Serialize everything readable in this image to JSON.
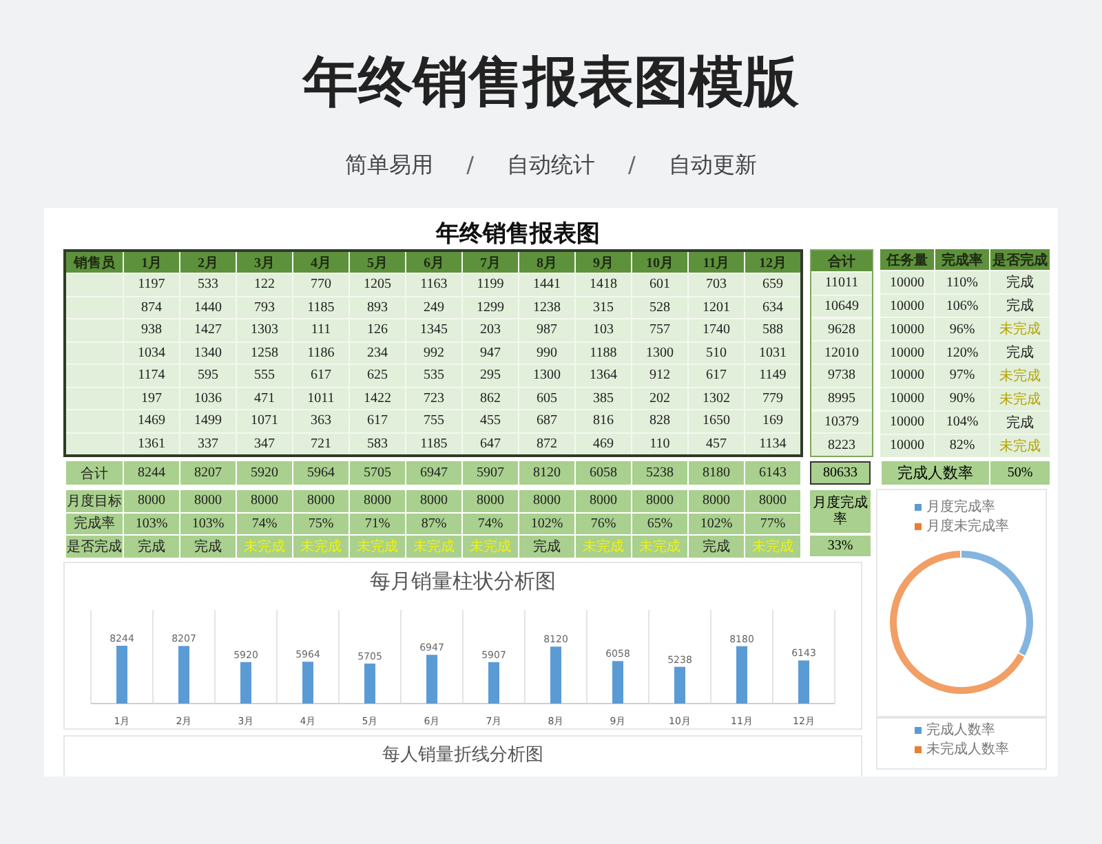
{
  "page_title": "年终销售报表图模版",
  "features": [
    "简单易用",
    "自动统计",
    "自动更新"
  ],
  "feature_separator": "/",
  "sheet_title": "年终销售报表图",
  "sales_table": {
    "columns": [
      "销售员",
      "1月",
      "2月",
      "3月",
      "4月",
      "5月",
      "6月",
      "7月",
      "8月",
      "9月",
      "10月",
      "11月",
      "12月"
    ],
    "rows": [
      {
        "values": [
          "1197",
          "533",
          "122",
          "770",
          "1205",
          "1163",
          "1199",
          "1441",
          "1418",
          "601",
          "703",
          "659"
        ]
      },
      {
        "values": [
          "874",
          "1440",
          "793",
          "1185",
          "893",
          "249",
          "1299",
          "1238",
          "315",
          "528",
          "1201",
          "634"
        ]
      },
      {
        "values": [
          "938",
          "1427",
          "1303",
          "111",
          "126",
          "1345",
          "203",
          "987",
          "103",
          "757",
          "1740",
          "588"
        ]
      },
      {
        "values": [
          "1034",
          "1340",
          "1258",
          "1186",
          "234",
          "992",
          "947",
          "990",
          "1188",
          "1300",
          "510",
          "1031"
        ]
      },
      {
        "values": [
          "1174",
          "595",
          "555",
          "617",
          "625",
          "535",
          "295",
          "1300",
          "1364",
          "912",
          "617",
          "1149"
        ]
      },
      {
        "values": [
          "197",
          "1036",
          "471",
          "1011",
          "1422",
          "723",
          "862",
          "605",
          "385",
          "202",
          "1302",
          "779"
        ]
      },
      {
        "values": [
          "1469",
          "1499",
          "1071",
          "363",
          "617",
          "755",
          "455",
          "687",
          "816",
          "828",
          "1650",
          "169"
        ]
      },
      {
        "values": [
          "1361",
          "337",
          "347",
          "721",
          "583",
          "1185",
          "647",
          "872",
          "469",
          "110",
          "457",
          "1134"
        ]
      }
    ]
  },
  "totals_column": {
    "header": "合计",
    "values": [
      "11011",
      "10649",
      "9628",
      "12010",
      "9738",
      "8995",
      "10379",
      "8223"
    ]
  },
  "task_table": {
    "columns": [
      "任务量",
      "完成率",
      "是否完成"
    ],
    "rows": [
      {
        "task": "10000",
        "rate": "110%",
        "status": "完成",
        "completed": true
      },
      {
        "task": "10000",
        "rate": "106%",
        "status": "完成",
        "completed": true
      },
      {
        "task": "10000",
        "rate": "96%",
        "status": "未完成",
        "completed": false
      },
      {
        "task": "10000",
        "rate": "120%",
        "status": "完成",
        "completed": true
      },
      {
        "task": "10000",
        "rate": "97%",
        "status": "未完成",
        "completed": false
      },
      {
        "task": "10000",
        "rate": "90%",
        "status": "未完成",
        "completed": false
      },
      {
        "task": "10000",
        "rate": "104%",
        "status": "完成",
        "completed": true
      },
      {
        "task": "10000",
        "rate": "82%",
        "status": "未完成",
        "completed": false
      }
    ]
  },
  "monthly_summary": {
    "total_label": "合计",
    "totals": [
      "8244",
      "8207",
      "5920",
      "5964",
      "5705",
      "6947",
      "5907",
      "8120",
      "6058",
      "5238",
      "8180",
      "6143"
    ],
    "grand_total": "80633",
    "target_label": "月度目标",
    "targets": [
      "8000",
      "8000",
      "8000",
      "8000",
      "8000",
      "8000",
      "8000",
      "8000",
      "8000",
      "8000",
      "8000",
      "8000"
    ],
    "rate_label": "完成率",
    "rates": [
      "103%",
      "103%",
      "74%",
      "75%",
      "71%",
      "87%",
      "74%",
      "102%",
      "76%",
      "65%",
      "102%",
      "77%"
    ],
    "status_label": "是否完成",
    "statuses": [
      {
        "text": "完成",
        "completed": true
      },
      {
        "text": "完成",
        "completed": true
      },
      {
        "text": "未完成",
        "completed": false
      },
      {
        "text": "未完成",
        "completed": false
      },
      {
        "text": "未完成",
        "completed": false
      },
      {
        "text": "未完成",
        "completed": false
      },
      {
        "text": "未完成",
        "completed": false
      },
      {
        "text": "完成",
        "completed": true
      },
      {
        "text": "未完成",
        "completed": false
      },
      {
        "text": "未完成",
        "completed": false
      },
      {
        "text": "完成",
        "completed": true
      },
      {
        "text": "未完成",
        "completed": false
      }
    ]
  },
  "monthly_rate": {
    "label": "月度完成率",
    "value": "33%"
  },
  "person_rate": {
    "label": "完成人数率",
    "value": "50%"
  },
  "bar_chart": {
    "chart_data": {
      "type": "bar",
      "title": "每月销量柱状分析图",
      "categories": [
        "1月",
        "2月",
        "3月",
        "4月",
        "5月",
        "6月",
        "7月",
        "8月",
        "9月",
        "10月",
        "11月",
        "12月"
      ],
      "values": [
        8244,
        8207,
        5920,
        5964,
        5705,
        6947,
        5907,
        8120,
        6058,
        5238,
        8180,
        6143
      ],
      "value_labels": [
        "8244",
        "8207",
        "5920",
        "5964",
        "5705",
        "6947",
        "5907",
        "8120",
        "6058",
        "5238",
        "8180",
        "6143"
      ]
    }
  },
  "line_chart": {
    "title": "每人销量折线分析图"
  },
  "donut_chart": {
    "chart_data": {
      "type": "donut",
      "categories": [
        "月度完成率",
        "月度未完成率"
      ],
      "values": [
        33,
        67
      ]
    }
  },
  "person_legend": {
    "items": [
      {
        "label": "完成人数率",
        "color": "#5b9bd5"
      },
      {
        "label": "未完成人数率",
        "color": "#ed7d31"
      }
    ]
  }
}
